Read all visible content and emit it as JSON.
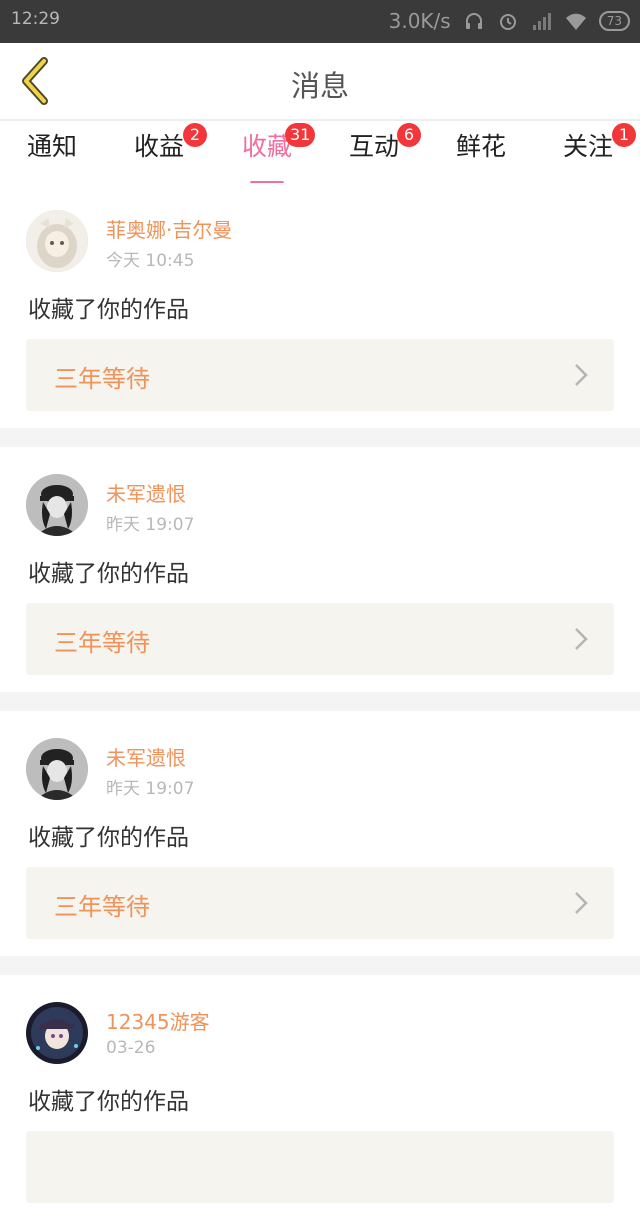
{
  "status_bar": {
    "time": "12:29",
    "net_speed": "3.0K/s",
    "battery": "73"
  },
  "header": {
    "title": "消息"
  },
  "tabs": [
    {
      "label": "通知",
      "badge": ""
    },
    {
      "label": "收益",
      "badge": "2"
    },
    {
      "label": "收藏",
      "badge": "31",
      "active": true
    },
    {
      "label": "互动",
      "badge": "6"
    },
    {
      "label": "鲜花",
      "badge": ""
    },
    {
      "label": "关注",
      "badge": "1"
    }
  ],
  "messages": [
    {
      "username": "菲奥娜·吉尔曼",
      "time": "今天 10:45",
      "action": "收藏了你的作品",
      "work": "三年等待"
    },
    {
      "username": "未军遗恨",
      "time": "昨天 19:07",
      "action": "收藏了你的作品",
      "work": "三年等待"
    },
    {
      "username": "未军遗恨",
      "time": "昨天 19:07",
      "action": "收藏了你的作品",
      "work": "三年等待"
    },
    {
      "username": "12345游客",
      "time": "03-26",
      "action": "收藏了你的作品",
      "work": ""
    }
  ],
  "colors": {
    "accent": "#f06ea0",
    "name": "#f0935a",
    "badge": "#f2363a"
  }
}
